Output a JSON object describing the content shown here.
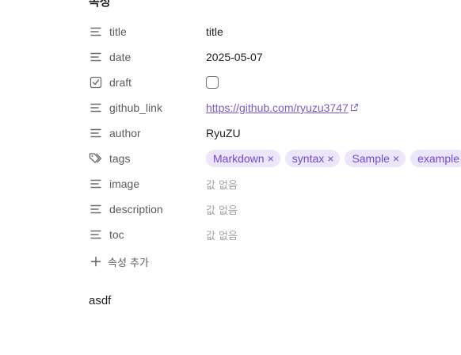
{
  "section": {
    "heading": "속성"
  },
  "properties": [
    {
      "name": "title",
      "icon": "text-lines-icon",
      "value": "title"
    },
    {
      "name": "date",
      "icon": "text-lines-icon",
      "value": "2025-05-07"
    },
    {
      "name": "draft",
      "icon": "checkbox-checked-icon",
      "value_checked": false
    },
    {
      "name": "github_link",
      "icon": "text-lines-icon",
      "value": "https://github.com/ryuzu3747"
    },
    {
      "name": "author",
      "icon": "text-lines-icon",
      "value": "RyuZU"
    },
    {
      "name": "tags",
      "icon": "tags-icon",
      "tags": [
        "Markdown",
        "syntax",
        "Sample",
        "example"
      ]
    },
    {
      "name": "image",
      "icon": "text-lines-icon",
      "value": "값 없음"
    },
    {
      "name": "description",
      "icon": "text-lines-icon",
      "value": "값 없음"
    },
    {
      "name": "toc",
      "icon": "text-lines-icon",
      "value": "값 없음"
    }
  ],
  "add_property": {
    "label": "속성 추가",
    "icon": "plus-icon"
  },
  "tag_remove_glyph": "×",
  "content": {
    "text": "asdf"
  },
  "colors": {
    "link": "#7a5ac8",
    "tag_bg": "#ece6fb",
    "tag_text": "#7048d6",
    "empty": "#a3a3a3"
  }
}
